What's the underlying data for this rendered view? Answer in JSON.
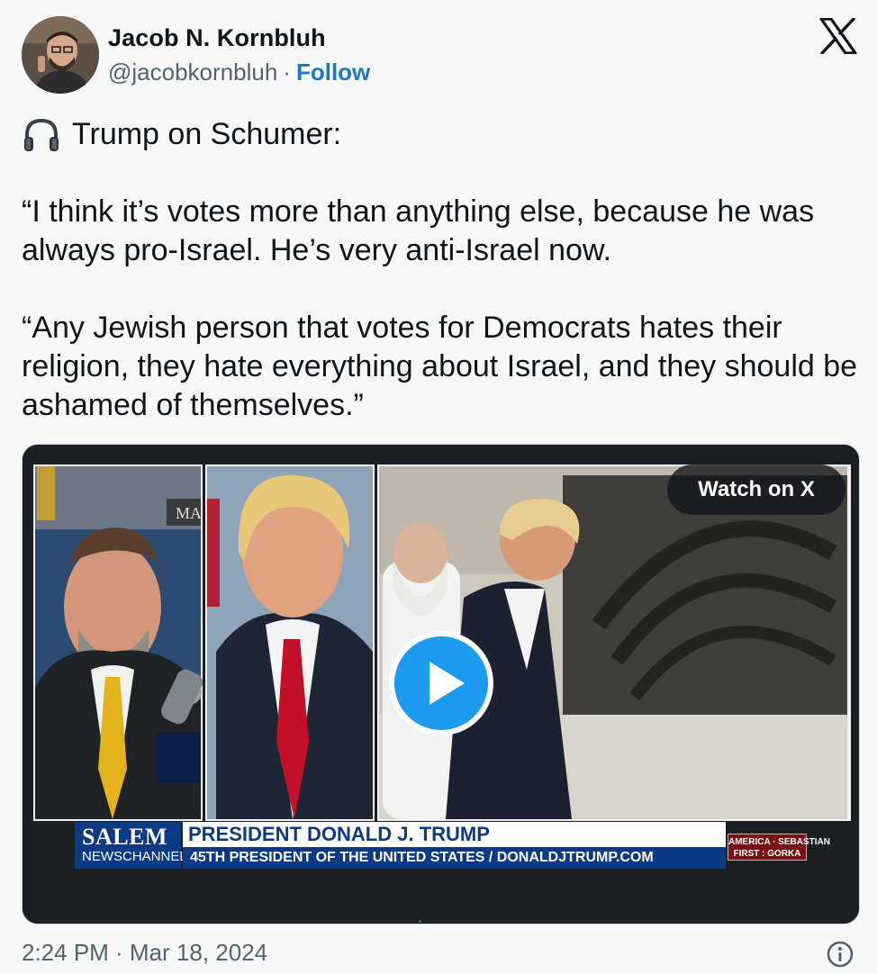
{
  "author": {
    "name": "Jacob N. Kornbluh",
    "handle": "@jacobkornbluh",
    "separator": "·",
    "follow_label": "Follow"
  },
  "icons": {
    "platform": "x-logo-icon",
    "headphones": "headphones-icon",
    "play": "play-icon",
    "info": "info-icon"
  },
  "tweet": {
    "line1": "Trump on Schumer:",
    "para1": "“I think it’s votes more than anything else, because he was always pro-Israel. He’s very anti-Israel now.",
    "para2": "“Any Jewish person that votes for Democrats hates their religion, they hate everything about Israel, and they should be ashamed of themselves.”"
  },
  "media": {
    "watch_label": "Watch on X",
    "lower_third": {
      "network_top": "SALEM",
      "network_bottom": "NEWSCHANNEL",
      "name": "PRESIDENT DONALD J. TRUMP",
      "title": "45TH PRESIDENT OF THE UNITED STATES / DONALDJTRUMP.COM",
      "show_badge_line1": "AMERICA · SEBASTIAN",
      "show_badge_line2": "FIRST : GORKA"
    }
  },
  "footer": {
    "timestamp": "2:24 PM · Mar 18, 2024"
  },
  "colors": {
    "background": "#f7f8f8",
    "text": "#0f1419",
    "secondary": "#536471",
    "link": "#1d79c8",
    "play": "#1d9bf0",
    "lower_third_blue": "#0d3a86"
  }
}
